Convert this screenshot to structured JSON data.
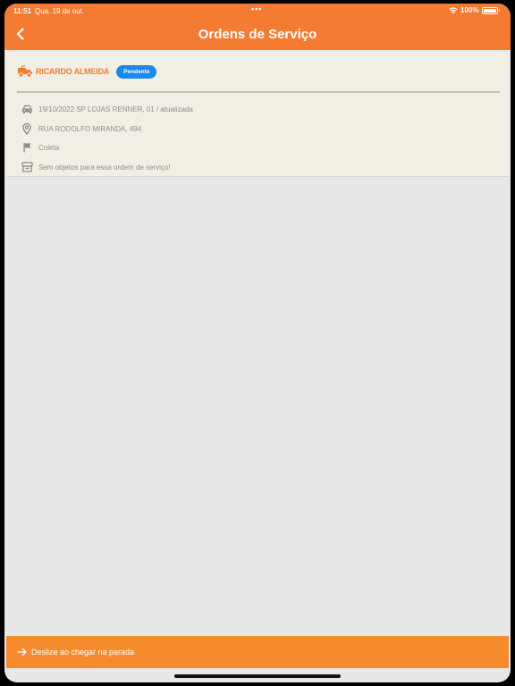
{
  "status_bar": {
    "time": "11:51",
    "date": "Qua. 19 de out.",
    "dots": "•••",
    "battery": "100%"
  },
  "header": {
    "title": "Ordens de Serviço"
  },
  "order": {
    "driver_name": "RICARDO ALMEIDA",
    "status": "Pendente",
    "rows": [
      {
        "icon": "car-icon",
        "text": "19/10/2022 SP LOJAS RENNER, 01 / atualizada"
      },
      {
        "icon": "location-pin-icon",
        "text": "RUA RODOLFO MIRANDA, 494"
      },
      {
        "icon": "flag-icon",
        "text": "Coleta"
      },
      {
        "icon": "box-icon",
        "text": "Sem objetos para essa ordem de serviço!"
      }
    ]
  },
  "footer": {
    "slide_label": "Deslize ao chegar na parada"
  },
  "colors": {
    "accent": "#f47b32",
    "badge": "#1b8ae6",
    "card_bg": "#f1eee4",
    "page_bg": "#e7e7e7"
  }
}
